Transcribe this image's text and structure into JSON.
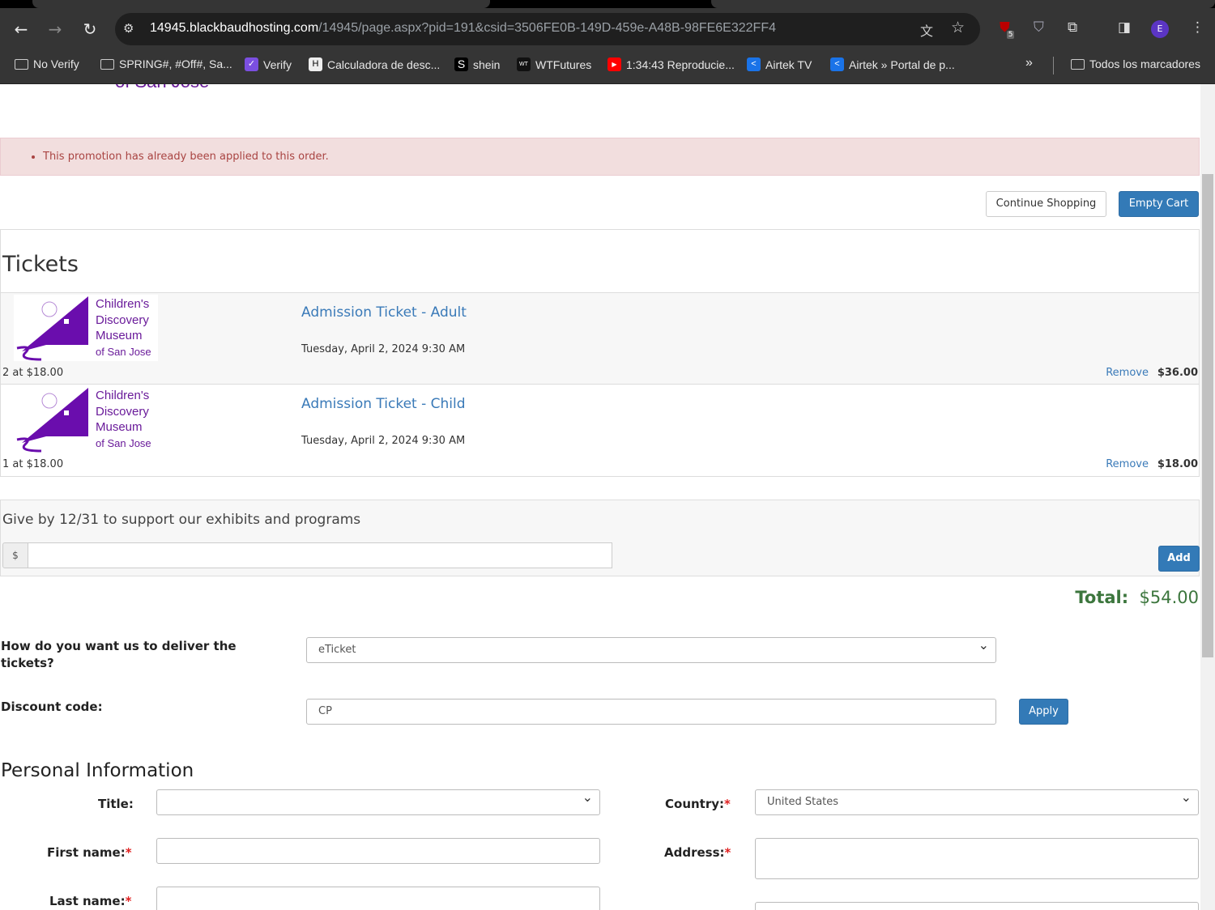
{
  "browser": {
    "url_host": "14945.blackbaudhosting.com",
    "url_path": "/14945/page.aspx?pid=191&csid=3506FE0B-149D-459e-A48B-98FE6E322FF4",
    "profile_initial": "E",
    "extension_badge": "5",
    "bookmarks": [
      {
        "label": "No Verify",
        "icon": "folder-icon"
      },
      {
        "label": "SPRING#, #Off#, Sa...",
        "icon": "folder-icon"
      },
      {
        "label": "Verify",
        "icon": "verify-icon"
      },
      {
        "label": "Calculadora de desc...",
        "icon": "calculator-icon"
      },
      {
        "label": "shein",
        "icon": "shein-icon"
      },
      {
        "label": "WTFutures",
        "icon": "wtfutures-icon"
      },
      {
        "label": "1:34:43 Reproducie...",
        "icon": "youtube-icon"
      },
      {
        "label": "Airtek TV",
        "icon": "airtek-icon"
      },
      {
        "label": "Airtek » Portal de p...",
        "icon": "airtek-icon"
      }
    ],
    "all_bookmarks": "Todos los marcadores"
  },
  "header": {
    "logo_partial": "of San Jose"
  },
  "alert": {
    "message": "This promotion has already been applied to this order."
  },
  "actions": {
    "continue": "Continue Shopping",
    "empty": "Empty Cart"
  },
  "tickets": {
    "title": "Tickets",
    "logo_text": [
      "Children's",
      "Discovery",
      "Museum",
      "of San Jose"
    ],
    "items": [
      {
        "name": "Admission Ticket - Adult",
        "date": "Tuesday, April 2, 2024 9:30 AM",
        "qty": "2 at $18.00",
        "remove": "Remove",
        "price": "$36.00"
      },
      {
        "name": "Admission Ticket - Child",
        "date": "Tuesday, April 2, 2024 9:30 AM",
        "qty": "1 at $18.00",
        "remove": "Remove",
        "price": "$18.00"
      }
    ]
  },
  "donation": {
    "title": "Give by 12/31 to support our exhibits and programs",
    "currency": "$",
    "value": "",
    "add": "Add"
  },
  "total": {
    "label": "Total:",
    "value": "$54.00"
  },
  "delivery": {
    "label": "How do you want us to deliver the tickets?",
    "value": "eTicket"
  },
  "discount": {
    "label": "Discount code:",
    "value": "CP",
    "apply": "Apply"
  },
  "personal": {
    "title": "Personal Information",
    "title_label": "Title:",
    "title_value": "",
    "first_label": "First name:",
    "last_label": "Last name:",
    "country_label": "Country:",
    "country_value": "United States",
    "address_label": "Address:",
    "required_mark": "*"
  },
  "colors": {
    "accent": "#337ab7",
    "alert_bg": "#f2dede",
    "alert_text": "#a94442",
    "total": "#3c763d",
    "logo": "#6a1b9a"
  }
}
